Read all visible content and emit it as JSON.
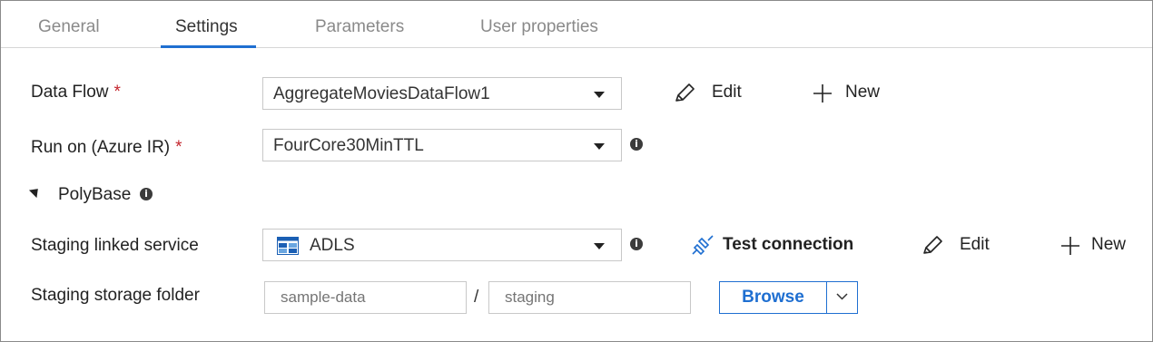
{
  "tabs": [
    {
      "label": "General"
    },
    {
      "label": "Settings"
    },
    {
      "label": "Parameters"
    },
    {
      "label": "User properties"
    }
  ],
  "active_tab": "Settings",
  "colors": {
    "accent": "#1f6fd1",
    "required": "#c4262e"
  },
  "form": {
    "data_flow": {
      "label": "Data Flow",
      "required_marker": "*",
      "value": "AggregateMoviesDataFlow1",
      "edit_label": "Edit",
      "new_label": "New"
    },
    "run_on": {
      "label": "Run on (Azure IR)",
      "required_marker": "*",
      "value": "FourCore30MinTTL",
      "info_icon": "info-icon"
    },
    "polybase": {
      "label": "PolyBase",
      "expanded": true,
      "info_icon": "info-icon"
    },
    "staging_linked_service": {
      "label": "Staging linked service",
      "value": "ADLS",
      "service_icon": "storage-icon",
      "test_connection_label": "Test connection",
      "edit_label": "Edit",
      "new_label": "New"
    },
    "staging_storage_folder": {
      "label": "Staging storage folder",
      "container_placeholder": "sample-data",
      "path_placeholder": "staging",
      "separator": "/",
      "browse_label": "Browse"
    }
  }
}
